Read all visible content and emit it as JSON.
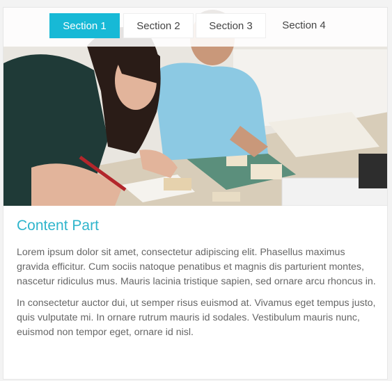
{
  "tabs": [
    {
      "label": "Section 1",
      "active": true
    },
    {
      "label": "Section 2",
      "active": false
    },
    {
      "label": "Section 3",
      "active": false
    },
    {
      "label": "Section 4",
      "active": false
    }
  ],
  "accent_color": "#17b9d6",
  "content": {
    "title": "Content Part",
    "paragraphs": [
      "Lorem ipsum dolor sit amet, consectetur adipiscing elit. Phasellus maximus gravida efficitur. Cum sociis natoque penatibus et magnis dis parturient montes, nascetur ridiculus mus. Mauris lacinia tristique sapien, sed ornare arcu rhoncus in.",
      "In consectetur auctor dui, ut semper risus euismod at. Vivamus eget tempus justo, quis vulputate mi. In ornare rutrum mauris id sodales. Vestibulum mauris nunc, euismod non tempor eget, ornare id nisl."
    ]
  }
}
